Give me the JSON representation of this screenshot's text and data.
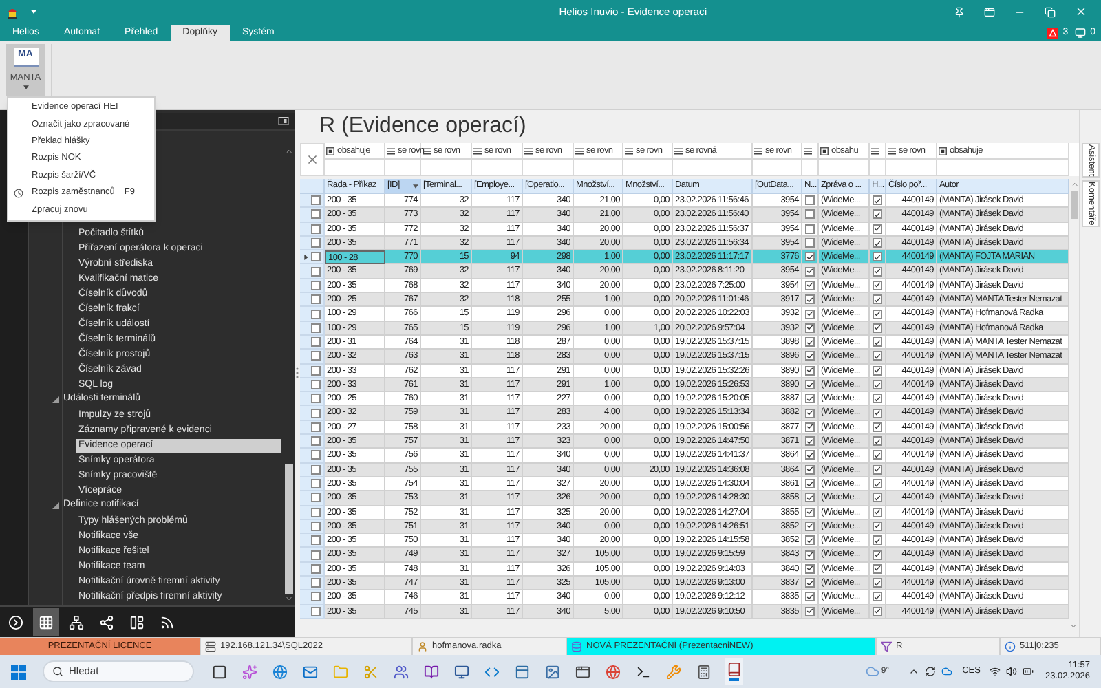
{
  "window": {
    "title": "Helios Inuvio - Evidence operací"
  },
  "tabs": [
    {
      "label": "Helios",
      "selected": false
    },
    {
      "label": "Automat",
      "selected": false
    },
    {
      "label": "Přehled",
      "selected": false
    },
    {
      "label": "Doplňky",
      "selected": true
    },
    {
      "label": "Systém",
      "selected": false
    }
  ],
  "notifications": [
    {
      "kind": "alert",
      "count": "3"
    },
    {
      "kind": "message",
      "count": "0"
    }
  ],
  "ribbon": {
    "button": {
      "logo_text": "MA",
      "label": "MANTA",
      "open": true
    }
  },
  "menu": [
    {
      "kind": "plain",
      "label": "Evidence operací HEI"
    },
    {
      "kind": "plain",
      "label": "Označit jako zpracované"
    },
    {
      "kind": "plain",
      "label": "Překlad hlášky"
    },
    {
      "kind": "plain",
      "label": "Rozpis NOK"
    },
    {
      "kind": "plain",
      "label": "Rozpis šarží/VČ"
    },
    {
      "kind": "icon",
      "label": "Rozpis zaměstnanců",
      "shortcut": "F9"
    },
    {
      "kind": "plain",
      "label": "Zpracuj znovu"
    }
  ],
  "sidebar": {
    "tree": [
      {
        "children": [
          {
            "label": "Počitadlo štítků",
            "selected": false
          },
          {
            "label": "Přiřazení operátora k operaci",
            "selected": false
          },
          {
            "label": "Výrobní střediska",
            "selected": false
          },
          {
            "label": "Kvalifikační matice",
            "selected": false
          },
          {
            "label": "Číselník důvodů",
            "selected": false
          },
          {
            "label": "Číselník frakcí",
            "selected": false
          },
          {
            "label": "Číselník událostí",
            "selected": false
          },
          {
            "label": "Číselník terminálů",
            "selected": false
          },
          {
            "label": "Číselník prostojů",
            "selected": false
          },
          {
            "label": "Číselník závad",
            "selected": false
          },
          {
            "label": "SQL log",
            "selected": false
          }
        ]
      },
      {
        "label": "Události terminálů",
        "expanded": true,
        "children": [
          {
            "label": "Impulzy ze strojů",
            "selected": false
          },
          {
            "label": "Záznamy připravené k evidenci",
            "selected": false
          },
          {
            "label": "Evidence operací",
            "selected": true
          },
          {
            "label": "Snímky operátora",
            "selected": false
          },
          {
            "label": "Snímky pracoviště",
            "selected": false
          },
          {
            "label": "Vícepráce",
            "selected": false
          }
        ]
      },
      {
        "label": "Definice notifikací",
        "expanded": true,
        "children": [
          {
            "label": "Typy hlášených problémů",
            "selected": false
          },
          {
            "label": "Notifikace vše",
            "selected": false
          },
          {
            "label": "Notifikace řešitel",
            "selected": false
          },
          {
            "label": "Notifikace team",
            "selected": false
          },
          {
            "label": "Notifikační úrovně firemní aktivity",
            "selected": false
          },
          {
            "label": "Notifikační předpis firemní aktivity",
            "selected": false
          }
        ]
      }
    ],
    "toolbar": [
      {
        "selected": false
      },
      {
        "selected": true
      },
      {
        "selected": false
      },
      {
        "selected": false
      },
      {
        "selected": false
      },
      {
        "selected": false
      }
    ]
  },
  "page_title": "R (Evidence operací)",
  "table": {
    "columns": [
      {
        "label": "Řada - Příkaz",
        "kind": "text",
        "filter": {
          "kind": "contains",
          "label": "obsahuje"
        },
        "sorted": false
      },
      {
        "label": "[ID]",
        "kind": "text",
        "filter": {
          "kind": "equals",
          "label": "se rovn"
        },
        "sorted": true
      },
      {
        "label": "[Terminal...",
        "kind": "text",
        "filter": {
          "kind": "equals",
          "label": "se rovn"
        },
        "sorted": false
      },
      {
        "label": "[Employe...",
        "kind": "text",
        "filter": {
          "kind": "equals",
          "label": "se rovn"
        },
        "sorted": false
      },
      {
        "label": "[Operatio...",
        "kind": "text",
        "filter": {
          "kind": "equals",
          "label": "se rovn"
        },
        "sorted": false
      },
      {
        "label": "Množství...",
        "kind": "text",
        "filter": {
          "kind": "equals",
          "label": "se rovn"
        },
        "sorted": false
      },
      {
        "label": "Množství...",
        "kind": "text",
        "filter": {
          "kind": "equals",
          "label": "se rovn"
        },
        "sorted": false
      },
      {
        "label": "Datum",
        "kind": "text",
        "filter": {
          "kind": "equals",
          "label": "se rovná"
        },
        "sorted": false
      },
      {
        "label": "[OutData...",
        "kind": "text",
        "filter": {
          "kind": "equals",
          "label": "se rovn"
        },
        "sorted": false
      },
      {
        "label": "N...",
        "kind": "check",
        "filter": {
          "kind": "equals"
        },
        "sorted": false
      },
      {
        "label": "Zpráva o ...",
        "kind": "text",
        "filter": {
          "kind": "contains",
          "label": "obsahu"
        },
        "sorted": false
      },
      {
        "label": "H...",
        "kind": "check",
        "filter": {
          "kind": "equals"
        },
        "sorted": false
      },
      {
        "label": "Číslo poř...",
        "kind": "text",
        "filter": {
          "kind": "equals",
          "label": "se rovn"
        },
        "sorted": false
      },
      {
        "label": "Autor",
        "kind": "text",
        "filter": {
          "kind": "contains",
          "label": "obsahuje"
        },
        "sorted": false
      }
    ],
    "rows": [
      {
        "checked": false,
        "selected": false,
        "cells": [
          "200 - 35",
          "774",
          "32",
          "117",
          "340",
          "21,00",
          "0,00",
          "23.02.2026 11:56:46",
          "3954",
          false,
          "(WideMe...",
          true,
          "4400149",
          "(MANTA) Jirásek David"
        ]
      },
      {
        "checked": false,
        "selected": false,
        "cells": [
          "200 - 35",
          "773",
          "32",
          "117",
          "340",
          "21,00",
          "0,00",
          "23.02.2026 11:56:40",
          "3954",
          false,
          "(WideMe...",
          true,
          "4400149",
          "(MANTA) Jirásek David"
        ]
      },
      {
        "checked": false,
        "selected": false,
        "cells": [
          "200 - 35",
          "772",
          "32",
          "117",
          "340",
          "20,00",
          "0,00",
          "23.02.2026 11:56:37",
          "3954",
          false,
          "(WideMe...",
          true,
          "4400149",
          "(MANTA) Jirásek David"
        ]
      },
      {
        "checked": false,
        "selected": false,
        "cells": [
          "200 - 35",
          "771",
          "32",
          "117",
          "340",
          "20,00",
          "0,00",
          "23.02.2026 11:56:34",
          "3954",
          false,
          "(WideMe...",
          true,
          "4400149",
          "(MANTA) Jirásek David"
        ]
      },
      {
        "checked": false,
        "selected": true,
        "cells": [
          "100 - 28",
          "770",
          "15",
          "94",
          "298",
          "1,00",
          "0,00",
          "23.02.2026 11:17:17",
          "3776",
          true,
          "(WideMe...",
          true,
          "4400149",
          "(MANTA) FOJTA MARIAN"
        ]
      },
      {
        "checked": false,
        "selected": false,
        "cells": [
          "200 - 35",
          "769",
          "32",
          "117",
          "340",
          "20,00",
          "0,00",
          "23.02.2026 8:11:20",
          "3954",
          true,
          "(WideMe...",
          true,
          "4400149",
          "(MANTA) Jirásek David"
        ]
      },
      {
        "checked": false,
        "selected": false,
        "cells": [
          "200 - 35",
          "768",
          "32",
          "117",
          "340",
          "20,00",
          "0,00",
          "23.02.2026 7:25:00",
          "3954",
          true,
          "(WideMe...",
          true,
          "4400149",
          "(MANTA) Jirásek David"
        ]
      },
      {
        "checked": false,
        "selected": false,
        "cells": [
          "200 - 25",
          "767",
          "32",
          "118",
          "255",
          "1,00",
          "0,00",
          "20.02.2026 11:01:46",
          "3917",
          true,
          "(WideMe...",
          true,
          "4400149",
          "(MANTA) MANTA Tester Nemazat"
        ]
      },
      {
        "checked": false,
        "selected": false,
        "cells": [
          "100 - 29",
          "766",
          "15",
          "119",
          "296",
          "0,00",
          "0,00",
          "20.02.2026 10:22:03",
          "3932",
          true,
          "(WideMe...",
          true,
          "4400149",
          "(MANTA) Hofmanová Radka"
        ]
      },
      {
        "checked": false,
        "selected": false,
        "cells": [
          "100 - 29",
          "765",
          "15",
          "119",
          "296",
          "1,00",
          "1,00",
          "20.02.2026 9:57:04",
          "3932",
          true,
          "(WideMe...",
          true,
          "4400149",
          "(MANTA) Hofmanová Radka"
        ]
      },
      {
        "checked": false,
        "selected": false,
        "cells": [
          "200 - 31",
          "764",
          "31",
          "118",
          "287",
          "0,00",
          "0,00",
          "19.02.2026 15:37:15",
          "3898",
          true,
          "(WideMe...",
          true,
          "4400149",
          "(MANTA) MANTA Tester Nemazat"
        ]
      },
      {
        "checked": false,
        "selected": false,
        "cells": [
          "200 - 32",
          "763",
          "31",
          "118",
          "283",
          "0,00",
          "0,00",
          "19.02.2026 15:37:15",
          "3896",
          true,
          "(WideMe...",
          true,
          "4400149",
          "(MANTA) MANTA Tester Nemazat"
        ]
      },
      {
        "checked": false,
        "selected": false,
        "cells": [
          "200 - 33",
          "762",
          "31",
          "117",
          "291",
          "0,00",
          "0,00",
          "19.02.2026 15:32:26",
          "3890",
          true,
          "(WideMe...",
          true,
          "4400149",
          "(MANTA) Jirásek David"
        ]
      },
      {
        "checked": false,
        "selected": false,
        "cells": [
          "200 - 33",
          "761",
          "31",
          "117",
          "291",
          "1,00",
          "0,00",
          "19.02.2026 15:26:53",
          "3890",
          true,
          "(WideMe...",
          true,
          "4400149",
          "(MANTA) Jirásek David"
        ]
      },
      {
        "checked": false,
        "selected": false,
        "cells": [
          "200 - 25",
          "760",
          "31",
          "117",
          "227",
          "0,00",
          "0,00",
          "19.02.2026 15:20:05",
          "3887",
          true,
          "(WideMe...",
          true,
          "4400149",
          "(MANTA) Jirásek David"
        ]
      },
      {
        "checked": false,
        "selected": false,
        "cells": [
          "200 - 32",
          "759",
          "31",
          "117",
          "283",
          "4,00",
          "0,00",
          "19.02.2026 15:13:34",
          "3882",
          true,
          "(WideMe...",
          true,
          "4400149",
          "(MANTA) Jirásek David"
        ]
      },
      {
        "checked": false,
        "selected": false,
        "cells": [
          "200 - 27",
          "758",
          "31",
          "117",
          "233",
          "20,00",
          "0,00",
          "19.02.2026 15:00:56",
          "3877",
          true,
          "(WideMe...",
          true,
          "4400149",
          "(MANTA) Jirásek David"
        ]
      },
      {
        "checked": false,
        "selected": false,
        "cells": [
          "200 - 35",
          "757",
          "31",
          "117",
          "323",
          "0,00",
          "0,00",
          "19.02.2026 14:47:50",
          "3871",
          true,
          "(WideMe...",
          true,
          "4400149",
          "(MANTA) Jirásek David"
        ]
      },
      {
        "checked": false,
        "selected": false,
        "cells": [
          "200 - 35",
          "756",
          "31",
          "117",
          "340",
          "0,00",
          "0,00",
          "19.02.2026 14:41:37",
          "3864",
          true,
          "(WideMe...",
          true,
          "4400149",
          "(MANTA) Jirásek David"
        ]
      },
      {
        "checked": false,
        "selected": false,
        "cells": [
          "200 - 35",
          "755",
          "31",
          "117",
          "340",
          "0,00",
          "20,00",
          "19.02.2026 14:36:08",
          "3864",
          true,
          "(WideMe...",
          true,
          "4400149",
          "(MANTA) Jirásek David"
        ]
      },
      {
        "checked": false,
        "selected": false,
        "cells": [
          "200 - 35",
          "754",
          "31",
          "117",
          "327",
          "20,00",
          "0,00",
          "19.02.2026 14:30:04",
          "3861",
          true,
          "(WideMe...",
          true,
          "4400149",
          "(MANTA) Jirásek David"
        ]
      },
      {
        "checked": false,
        "selected": false,
        "cells": [
          "200 - 35",
          "753",
          "31",
          "117",
          "326",
          "20,00",
          "0,00",
          "19.02.2026 14:28:30",
          "3858",
          true,
          "(WideMe...",
          true,
          "4400149",
          "(MANTA) Jirásek David"
        ]
      },
      {
        "checked": false,
        "selected": false,
        "cells": [
          "200 - 35",
          "752",
          "31",
          "117",
          "325",
          "20,00",
          "0,00",
          "19.02.2026 14:27:04",
          "3855",
          true,
          "(WideMe...",
          true,
          "4400149",
          "(MANTA) Jirásek David"
        ]
      },
      {
        "checked": false,
        "selected": false,
        "cells": [
          "200 - 35",
          "751",
          "31",
          "117",
          "340",
          "0,00",
          "0,00",
          "19.02.2026 14:26:51",
          "3852",
          true,
          "(WideMe...",
          true,
          "4400149",
          "(MANTA) Jirásek David"
        ]
      },
      {
        "checked": false,
        "selected": false,
        "cells": [
          "200 - 35",
          "750",
          "31",
          "117",
          "340",
          "20,00",
          "0,00",
          "19.02.2026 14:15:58",
          "3852",
          true,
          "(WideMe...",
          true,
          "4400149",
          "(MANTA) Jirásek David"
        ]
      },
      {
        "checked": false,
        "selected": false,
        "cells": [
          "200 - 35",
          "749",
          "31",
          "117",
          "327",
          "105,00",
          "0,00",
          "19.02.2026 9:15:59",
          "3843",
          true,
          "(WideMe...",
          true,
          "4400149",
          "(MANTA) Jirásek David"
        ]
      },
      {
        "checked": false,
        "selected": false,
        "cells": [
          "200 - 35",
          "748",
          "31",
          "117",
          "326",
          "105,00",
          "0,00",
          "19.02.2026 9:14:03",
          "3840",
          true,
          "(WideMe...",
          true,
          "4400149",
          "(MANTA) Jirásek David"
        ]
      },
      {
        "checked": false,
        "selected": false,
        "cells": [
          "200 - 35",
          "747",
          "31",
          "117",
          "325",
          "105,00",
          "0,00",
          "19.02.2026 9:13:00",
          "3837",
          true,
          "(WideMe...",
          true,
          "4400149",
          "(MANTA) Jirásek David"
        ]
      },
      {
        "checked": false,
        "selected": false,
        "cells": [
          "200 - 35",
          "746",
          "31",
          "117",
          "340",
          "0,00",
          "0,00",
          "19.02.2026 9:12:12",
          "3835",
          true,
          "(WideMe...",
          true,
          "4400149",
          "(MANTA) Jirásek David"
        ]
      },
      {
        "checked": false,
        "selected": false,
        "cells": [
          "200 - 35",
          "745",
          "31",
          "117",
          "340",
          "5,00",
          "0,00",
          "19.02.2026 9:10:50",
          "3835",
          true,
          "(WideMe...",
          true,
          "4400149",
          "(MANTA) Jirásek David"
        ]
      }
    ]
  },
  "side_tabs": [
    {
      "label": "Asistent"
    },
    {
      "label": "Komentáře"
    }
  ],
  "status_bar": [
    {
      "kind": "license",
      "text": "PREZENTAČNÍ LICENCE"
    },
    {
      "kind": "server",
      "text": "192.168.121.34\\SQL2022"
    },
    {
      "kind": "user",
      "text": "hofmanova.radka"
    },
    {
      "kind": "database",
      "text": "NOVÁ PREZENTAČNÍ (PrezentacniNEW)"
    },
    {
      "kind": "filter",
      "text": "R"
    },
    {
      "kind": "info",
      "text": "511|0:235"
    }
  ],
  "taskbar": {
    "search_placeholder": "Hledat",
    "apps": [
      {
        "active": false
      },
      {
        "active": false
      },
      {
        "active": false
      },
      {
        "active": false
      },
      {
        "active": false
      },
      {
        "active": false
      },
      {
        "active": false
      },
      {
        "active": false
      },
      {
        "active": false
      },
      {
        "active": false
      },
      {
        "active": false
      },
      {
        "active": false
      },
      {
        "active": false
      },
      {
        "active": false
      },
      {
        "active": false
      },
      {
        "active": false
      },
      {
        "active": false
      },
      {
        "active": true
      }
    ],
    "weather": "9°",
    "language": "CES",
    "time": "11:57",
    "date": "23.02.2026"
  }
}
